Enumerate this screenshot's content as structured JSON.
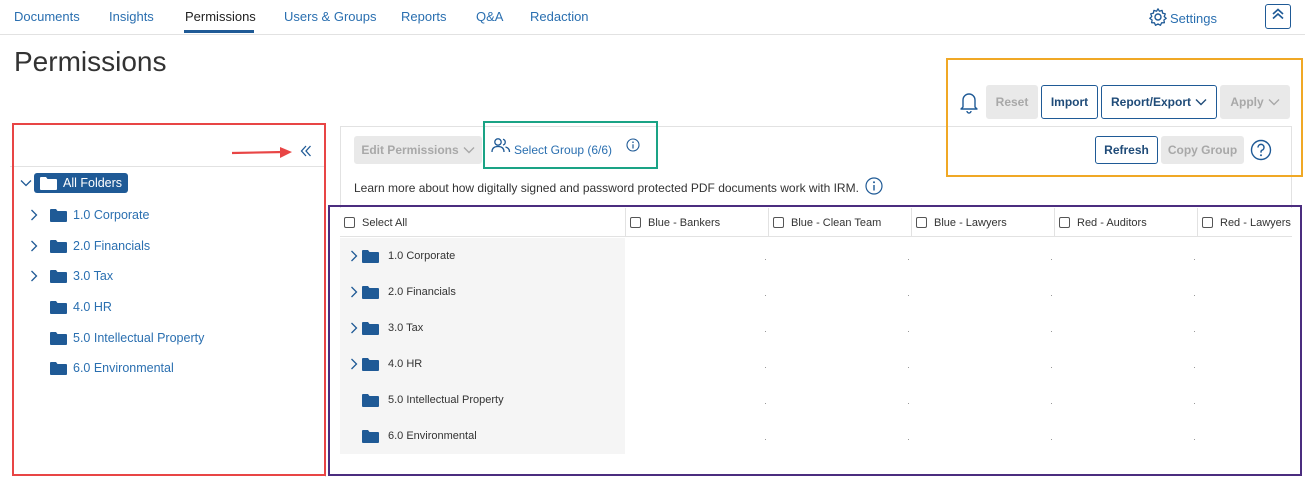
{
  "nav": {
    "tabs": [
      {
        "label": "Documents"
      },
      {
        "label": "Insights"
      },
      {
        "label": "Permissions"
      },
      {
        "label": "Users & Groups"
      },
      {
        "label": "Reports"
      },
      {
        "label": "Q&A"
      },
      {
        "label": "Redaction"
      }
    ],
    "active_tab": "Permissions",
    "settings_label": "Settings"
  },
  "page": {
    "title": "Permissions"
  },
  "toolbar": {
    "reset_label": "Reset",
    "import_label": "Import",
    "report_export_label": "Report/Export",
    "apply_label": "Apply",
    "refresh_label": "Refresh",
    "copy_group_label": "Copy Group",
    "edit_permissions_label": "Edit Permissions",
    "select_group_label": "Select Group (6/6)"
  },
  "info": {
    "text": "Learn more about how digitally signed and password protected PDF documents work with IRM."
  },
  "folder_tree": {
    "root_label": "All Folders",
    "items": [
      {
        "label": "1.0 Corporate",
        "expandable": true
      },
      {
        "label": "2.0 Financials",
        "expandable": true
      },
      {
        "label": "3.0 Tax",
        "expandable": true
      },
      {
        "label": "4.0 HR",
        "expandable": false
      },
      {
        "label": "5.0 Intellectual Property",
        "expandable": false
      },
      {
        "label": "6.0 Environmental",
        "expandable": false
      }
    ]
  },
  "grid": {
    "select_all_label": "Select All",
    "columns": [
      {
        "label": "Blue - Bankers"
      },
      {
        "label": "Blue - Clean Team"
      },
      {
        "label": "Blue - Lawyers"
      },
      {
        "label": "Red - Auditors"
      },
      {
        "label": "Red - Lawyers"
      }
    ],
    "rows": [
      {
        "label": "1.0 Corporate",
        "expandable": true
      },
      {
        "label": "2.0 Financials",
        "expandable": true
      },
      {
        "label": "3.0 Tax",
        "expandable": true
      },
      {
        "label": "4.0 HR",
        "expandable": true
      },
      {
        "label": "5.0 Intellectual Property",
        "expandable": false
      },
      {
        "label": "6.0 Environmental",
        "expandable": false
      }
    ]
  },
  "colors": {
    "accent": "#1f5a96",
    "link": "#2a6fb0",
    "annotation_red": "#e84545",
    "annotation_green": "#1aa385",
    "annotation_orange": "#f0a825",
    "annotation_purple": "#4b2d7f"
  }
}
